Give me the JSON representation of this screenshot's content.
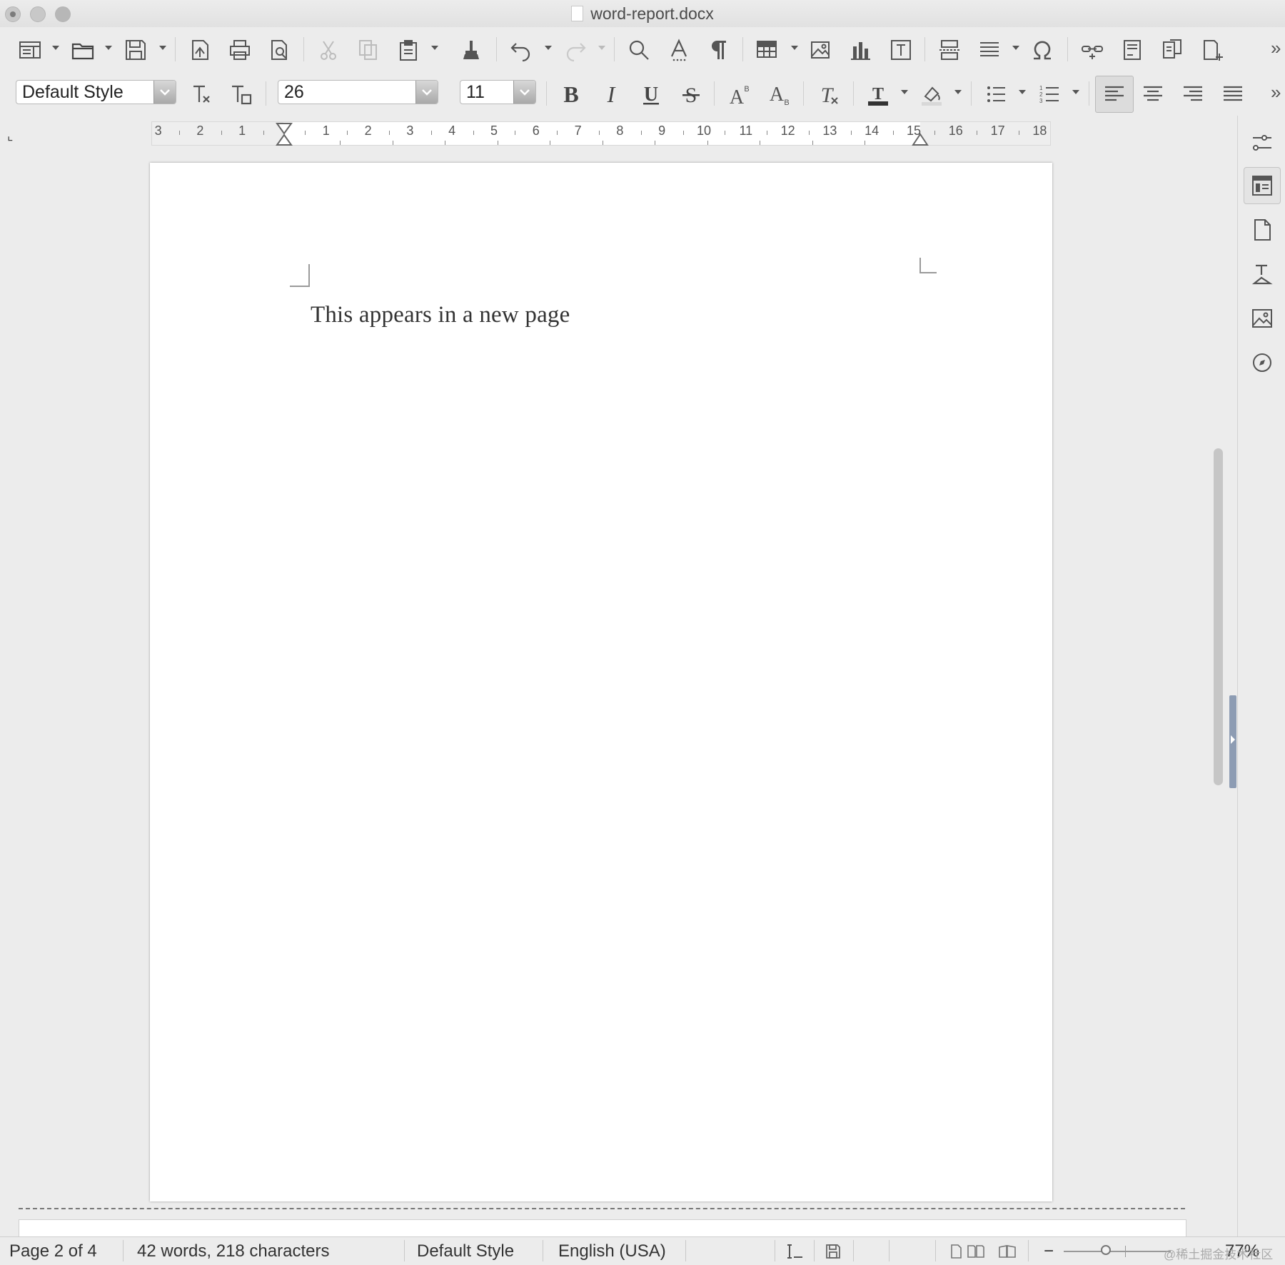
{
  "window": {
    "title": "word-report.docx"
  },
  "toolbar_standard": {
    "icons": [
      "sidebar-menu-icon",
      "open-folder-icon",
      "save-icon",
      "export-pdf-icon",
      "print-icon",
      "print-preview-icon",
      "cut-icon",
      "copy-icon",
      "paste-icon",
      "clone-formatting-icon",
      "undo-icon",
      "redo-icon",
      "find-replace-icon",
      "spelling-icon",
      "formatting-marks-icon",
      "insert-table-icon",
      "insert-image-icon",
      "insert-chart-icon",
      "insert-textbox-icon",
      "page-break-icon",
      "insert-field-icon",
      "special-character-icon",
      "hyperlink-icon",
      "footnote-icon",
      "comment-icon",
      "track-changes-icon"
    ]
  },
  "toolbar_formatting": {
    "paragraph_style": "Default Style",
    "font_name": "26",
    "font_size": "11",
    "overflow_label": "»"
  },
  "ruler": {
    "numbers": [
      "3",
      "2",
      "1",
      "1",
      "2",
      "3",
      "4",
      "5",
      "6",
      "7",
      "8",
      "9",
      "10",
      "11",
      "12",
      "13",
      "14",
      "15",
      "16",
      "17",
      "18"
    ]
  },
  "document": {
    "text": "This appears in a new page"
  },
  "sidebar": {
    "icons": [
      "properties-icon",
      "page-icon",
      "styles-icon",
      "gallery-icon",
      "navigator-icon"
    ]
  },
  "statusbar": {
    "page": "Page 2 of 4",
    "words": "42 words, 218 characters",
    "page_style": "Default Style",
    "language": "English (USA)",
    "zoom_minus": "−",
    "zoom": "77%",
    "watermark": "@稀土掘金技术社区"
  },
  "colors": {
    "page": "#ffffff",
    "chrome": "#ececec",
    "sidebar_handle": "#8d9cb3"
  }
}
